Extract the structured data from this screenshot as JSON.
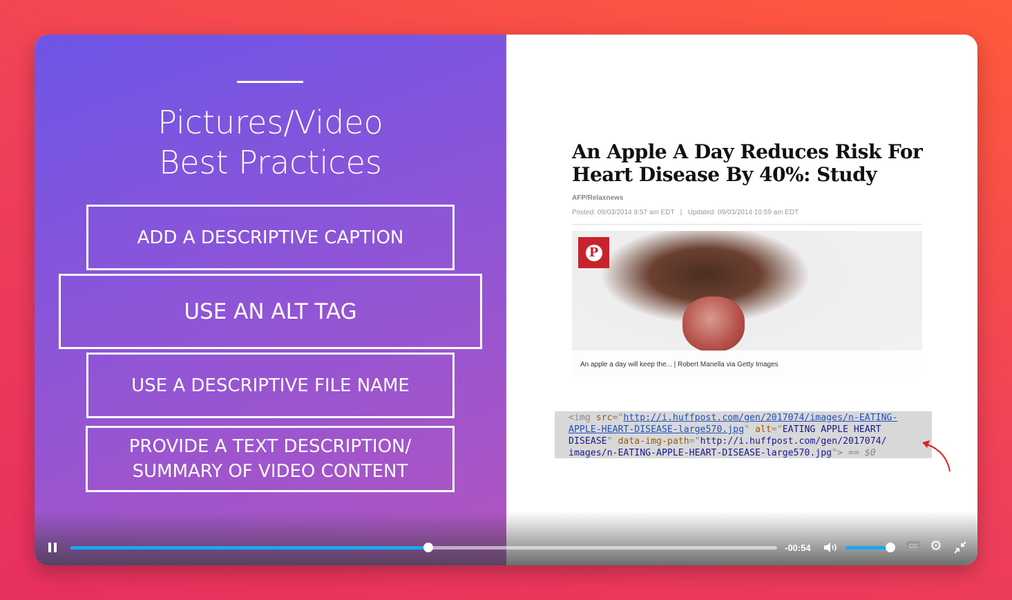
{
  "slide": {
    "title_line1": "Pictures/Video",
    "title_line2": "Best Practices",
    "items": [
      "ADD A DESCRIPTIVE CAPTION",
      "USE AN ALT TAG",
      "USE A DESCRIPTIVE FILE NAME",
      "PROVIDE A TEXT DESCRIPTION/",
      "SUMMARY OF VIDEO CONTENT"
    ]
  },
  "article": {
    "headline": "An Apple A Day Reduces Risk For Heart Disease By 40%: Study",
    "source": "AFP/Relaxnews",
    "posted": "Posted: 09/03/2014 9:57 am EDT",
    "separator": "|",
    "updated": "Updated: 09/03/2014 10:59 am EDT",
    "pinterest_glyph": "P",
    "caption": "An apple a day will keep the... | Robert Manella via Getty Images"
  },
  "code": {
    "tag_open": "<img ",
    "src_attr": "src",
    "eq": "=\"",
    "src_url_1": "http://i.huffpost.com/gen/2017074/images/n-EATING-",
    "src_url_2": "APPLE-HEART-DISEASE-large570.jpg",
    "alt_attr": "alt",
    "alt_value_1": "EATING APPLE HEART",
    "alt_value_2": "DISEASE",
    "path_attr": "data-img-path",
    "path_value_1": "http://i.huffpost.com/gen/2017074/",
    "path_value_2": "images/n-EATING-APPLE-HEART-DISEASE-large570.jpg",
    "tag_close": "\">",
    "console_ref": "== $0"
  },
  "player": {
    "progress_fraction": 0.506,
    "time_remaining": "-00:54",
    "volume_fraction": 1.0,
    "cc_label": "CC",
    "accent_color": "#1aa7f0"
  }
}
